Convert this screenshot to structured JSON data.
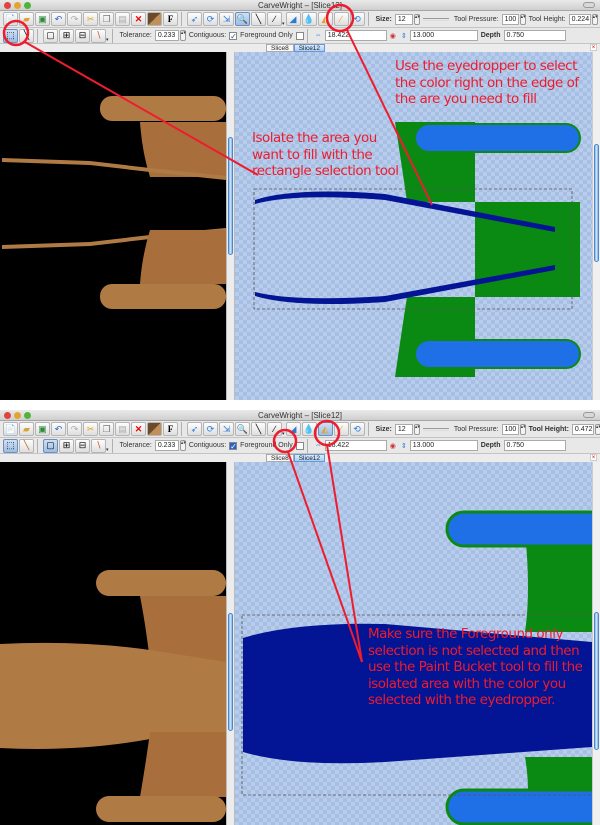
{
  "app": {
    "title": "CarveWright – [Slice12]",
    "tabs": [
      {
        "label": "Slice8",
        "active": false
      },
      {
        "label": "Slice12",
        "active": true
      }
    ]
  },
  "toolbar_main": {
    "icons": [
      "new-file-icon",
      "open-file-icon",
      "save-icon",
      "undo-icon",
      "redo-icon",
      "cut-icon",
      "copy-icon",
      "paste-icon",
      "delete-icon",
      "texture-icon",
      "font-icon",
      "select-arrow-icon",
      "rotate-icon",
      "move-icon",
      "zoom-icon",
      "knife-icon",
      "brush-icon",
      "eraser-icon",
      "water-drop-icon",
      "paint-bucket-icon",
      "eyedropper-icon",
      "color-swap-icon"
    ],
    "size_label": "Size:",
    "size_value": "12",
    "pressure_label": "Tool Pressure:",
    "pressure_value": "100",
    "height_label": "Tool Height:"
  },
  "toolbar_selection": {
    "icons": [
      "rect-select-icon",
      "magic-wand-icon",
      "select-new-icon",
      "select-add-icon",
      "select-subtract-icon",
      "wand-options-icon"
    ],
    "tolerance_label": "Tolerance:",
    "tolerance_value": "0.233",
    "contiguous_label": "Contiguous:",
    "contiguous_checked": true,
    "foreground_label": "Foreground Only",
    "foreground_checked": false,
    "width_value": "18.422",
    "length_value": "13.000",
    "depth_label": "Depth",
    "depth_value": "0.750"
  },
  "screens": [
    {
      "tool_height": "0.224",
      "selected_tool": "rect-select-icon",
      "highlighted_tool": "eyedropper-icon",
      "annotations": [
        "Use the eyedropper to select the color right on the edge of the are you need to fill",
        "Isolate the area you want to fill with the rectangle selection tool"
      ]
    },
    {
      "tool_height": "0.472",
      "selected_tool": "rect-select-icon",
      "highlighted_tool": "paint-bucket-icon",
      "annotations": [
        "Make sure the Foreground only selection is not selected and then use the Paint Bucket tool to fill the isolated area with the color you selected with the eyedropper."
      ]
    }
  ],
  "colors": {
    "annotation": "#ee1c2e",
    "fill_color": "#031494",
    "model_tan": "#b07a45",
    "engine_blue": "#1f6fe6",
    "hull_green": "#0a8a12"
  }
}
